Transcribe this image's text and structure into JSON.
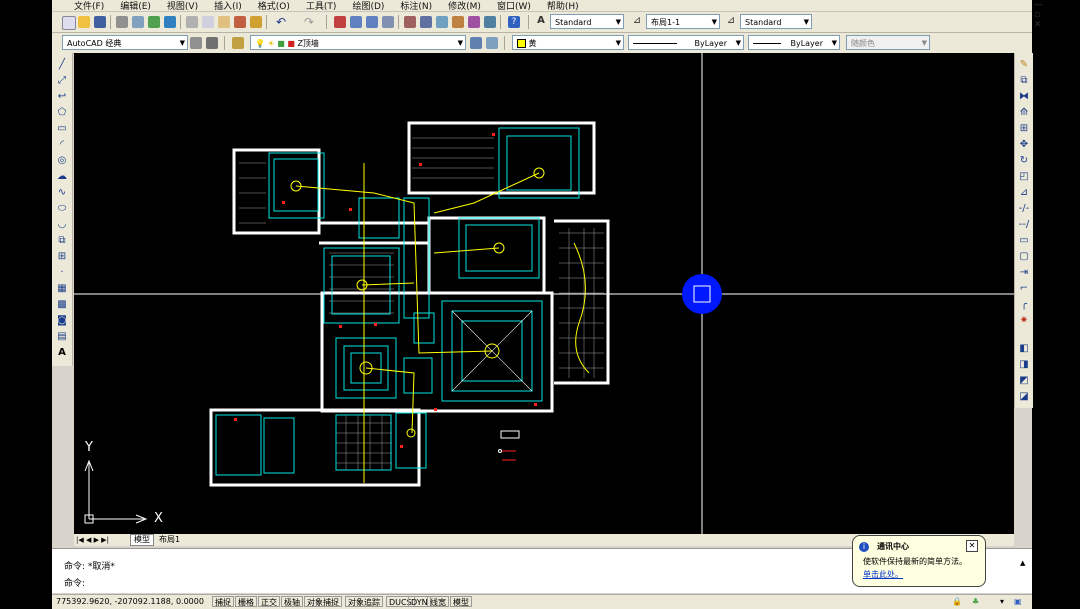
{
  "menu": [
    "文件(F)",
    "编辑(E)",
    "视图(V)",
    "插入(I)",
    "格式(O)",
    "工具(T)",
    "绘图(D)",
    "标注(N)",
    "修改(M)",
    "窗口(W)",
    "帮助(H)"
  ],
  "styles_toolbar": {
    "text_style": "Standard",
    "layout": "布局1-1",
    "dim_style": "Standard"
  },
  "workspace": "AutoCAD 经典",
  "layer": "Z顶墙",
  "properties": {
    "color": "黄",
    "linetype": "ByLayer",
    "lineweight": "ByLayer",
    "plotstyle": "随颜色"
  },
  "tabs": [
    "模型",
    "布局1"
  ],
  "command_lines": [
    "命令: *取消*",
    "命令:"
  ],
  "coordinates": "775392.9620, -207092.1188, 0.0000",
  "status_buttons": [
    "捕捉",
    "栅格",
    "正交",
    "极轴",
    "对象捕捉",
    "对象追踪",
    "DUCS",
    "DYN",
    "线宽",
    "模型"
  ],
  "ucs": {
    "x": "X",
    "y": "Y"
  },
  "notification": {
    "title": "通讯中心",
    "body": "使软件保持最新的简单方法。",
    "link": "单击此处。"
  },
  "colors": {
    "canvas": "#000000",
    "cyan": "#00e5e5",
    "yellow": "#ffff00",
    "red": "#ff2020",
    "white": "#ffffff",
    "cursor_blue": "#0018ff"
  }
}
